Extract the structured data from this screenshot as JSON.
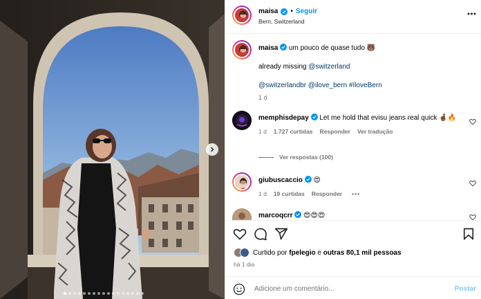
{
  "header": {
    "username": "maisa",
    "follow_separator": "•",
    "follow_label": "Seguir",
    "location": "Bern, Switzerland",
    "more_icon": "more-horizontal-icon"
  },
  "caption": {
    "username": "maisa",
    "line1": "um pouco de quase tudo 🐻",
    "line2_text": "already missing ",
    "line2_mention": "@switzerland",
    "line3": "@switzerlandbr @ilove_bern #IloveBern",
    "time": "1 d"
  },
  "comments": [
    {
      "username": "memphisdepay",
      "text": "Let me hold that evisu jeans real quick 🤞🏾🔥",
      "time": "1 d",
      "likes": "1.727 curtidas",
      "reply": "Responder",
      "translate": "Ver tradução",
      "replies": "Ver respostas (100)"
    },
    {
      "username": "giubuscaccio",
      "text": "😍",
      "time": "1 d",
      "likes": "19 curtidas",
      "reply": "Responder",
      "more": "•••"
    },
    {
      "username": "marcoqcrr",
      "text": "😍😍😍"
    }
  ],
  "likes": {
    "prefix": "Curtido por ",
    "user": "fpelegio",
    "middle": " e ",
    "others": "outras 80,1 mil pessoas"
  },
  "timestamp": "há 1 dia",
  "add_comment": {
    "placeholder": "Adicione um comentário...",
    "post_label": "Postar"
  },
  "carousel": {
    "total": 17,
    "active_index": 0
  },
  "colors": {
    "accent": "#0095f6",
    "link": "#00376b",
    "secondary": "#737373"
  }
}
